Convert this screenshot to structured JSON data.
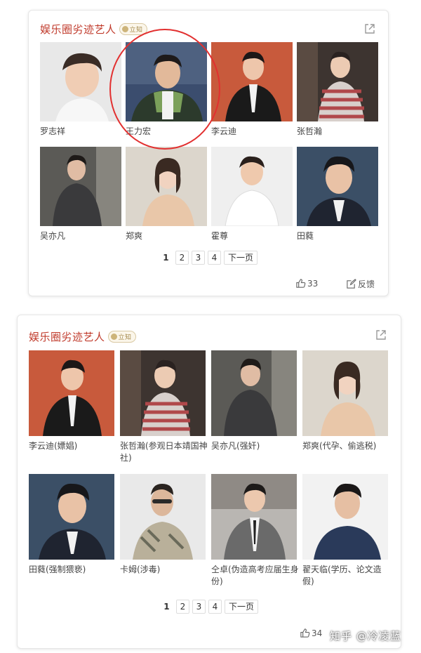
{
  "card1": {
    "title": "娱乐圈劣迹艺人",
    "badge": "立知",
    "people": [
      {
        "name": "罗志祥"
      },
      {
        "name": "王力宏"
      },
      {
        "name": "李云迪"
      },
      {
        "name": "张哲瀚"
      },
      {
        "name": "吴亦凡"
      },
      {
        "name": "郑爽"
      },
      {
        "name": "霍尊"
      },
      {
        "name": "田蕤"
      }
    ],
    "pagination": {
      "pages": [
        "1",
        "2",
        "3",
        "4"
      ],
      "next": "下一页",
      "current": "1"
    },
    "likes": "33",
    "feedback": "反馈"
  },
  "card2": {
    "title": "娱乐圈劣迹艺人",
    "badge": "立知",
    "people": [
      {
        "name": "李云迪(嫖娼)"
      },
      {
        "name": "张哲瀚(参观日本靖国神社)"
      },
      {
        "name": "吴亦凡(强奸)"
      },
      {
        "name": "郑爽(代孕、偷逃税)"
      },
      {
        "name": "田蕤(强制猥亵)"
      },
      {
        "name": "卡姆(涉毒)"
      },
      {
        "name": "仝卓(伪造高考应届生身份)"
      },
      {
        "name": "翟天临(学历、论文造假)"
      }
    ],
    "pagination": {
      "pages": [
        "1",
        "2",
        "3",
        "4"
      ],
      "next": "下一页",
      "current": "1"
    },
    "likes": "34"
  },
  "watermark": "知乎 @冷凌蓝",
  "colors": {
    "title": "#c03a2b",
    "highlight": "#e23030"
  },
  "icons": [
    "share-icon",
    "thumb-up-icon",
    "feedback-icon",
    "badge-icon"
  ]
}
